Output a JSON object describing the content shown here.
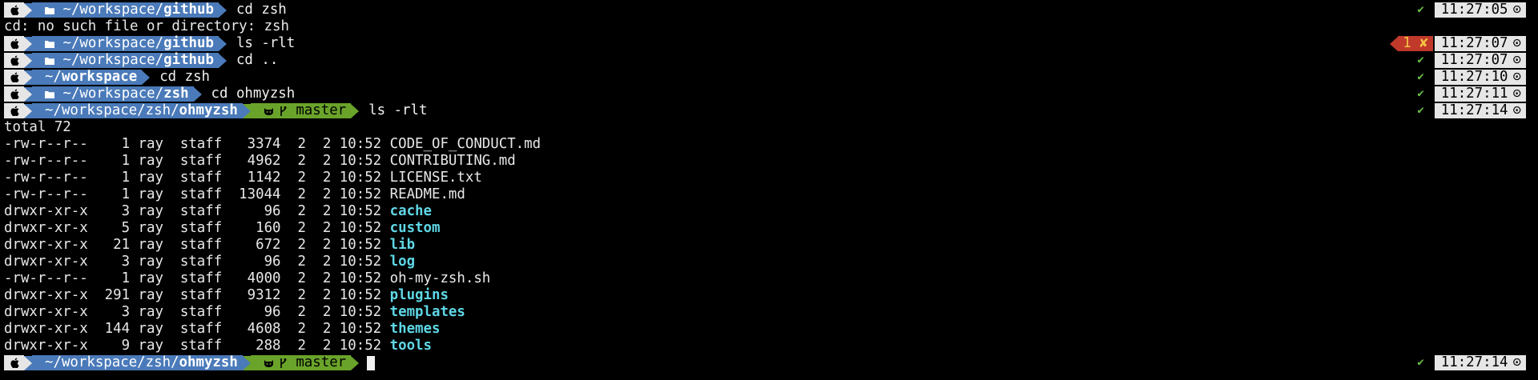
{
  "prompts": [
    {
      "path_prefix": "~/workspace/",
      "path_last": "github",
      "git": null,
      "command": "cd zsh",
      "status": "ok",
      "time": "11:27:05"
    },
    {
      "path_prefix": "~/workspace/",
      "path_last": "github",
      "git": null,
      "command": "ls -rlt",
      "status": "error",
      "error_code": "1",
      "error_mark": "✘",
      "time": "11:27:07"
    },
    {
      "path_prefix": "~/workspace/",
      "path_last": "github",
      "git": null,
      "command": "cd ..",
      "status": "ok",
      "time": "11:27:07"
    },
    {
      "path_prefix": "~/",
      "path_last": "workspace",
      "git": null,
      "command": "cd zsh",
      "status": "ok",
      "time": "11:27:10"
    },
    {
      "path_prefix": "~/workspace/",
      "path_last": "zsh",
      "git": null,
      "command": "cd ohmyzsh",
      "status": "ok",
      "time": "11:27:11"
    },
    {
      "path_prefix": "~/workspace/zsh/",
      "path_last": "ohmyzsh",
      "git": "master",
      "command": "ls -rlt",
      "status": "ok",
      "time": "11:27:14"
    },
    {
      "path_prefix": "~/workspace/zsh/",
      "path_last": "ohmyzsh",
      "git": "master",
      "command": "",
      "status": "ok",
      "time": "11:27:14"
    }
  ],
  "error_message": "cd: no such file or directory: zsh",
  "total_line": "total 72",
  "listing": [
    {
      "meta": "-rw-r--r--    1 ray  staff   3374  2  2 10:52 ",
      "name": "CODE_OF_CONDUCT.md",
      "dir": false
    },
    {
      "meta": "-rw-r--r--    1 ray  staff   4962  2  2 10:52 ",
      "name": "CONTRIBUTING.md",
      "dir": false
    },
    {
      "meta": "-rw-r--r--    1 ray  staff   1142  2  2 10:52 ",
      "name": "LICENSE.txt",
      "dir": false
    },
    {
      "meta": "-rw-r--r--    1 ray  staff  13044  2  2 10:52 ",
      "name": "README.md",
      "dir": false
    },
    {
      "meta": "drwxr-xr-x    3 ray  staff     96  2  2 10:52 ",
      "name": "cache",
      "dir": true
    },
    {
      "meta": "drwxr-xr-x    5 ray  staff    160  2  2 10:52 ",
      "name": "custom",
      "dir": true
    },
    {
      "meta": "drwxr-xr-x   21 ray  staff    672  2  2 10:52 ",
      "name": "lib",
      "dir": true
    },
    {
      "meta": "drwxr-xr-x    3 ray  staff     96  2  2 10:52 ",
      "name": "log",
      "dir": true
    },
    {
      "meta": "-rw-r--r--    1 ray  staff   4000  2  2 10:52 ",
      "name": "oh-my-zsh.sh",
      "dir": false
    },
    {
      "meta": "drwxr-xr-x  291 ray  staff   9312  2  2 10:52 ",
      "name": "plugins",
      "dir": true
    },
    {
      "meta": "drwxr-xr-x    3 ray  staff     96  2  2 10:52 ",
      "name": "templates",
      "dir": true
    },
    {
      "meta": "drwxr-xr-x  144 ray  staff   4608  2  2 10:52 ",
      "name": "themes",
      "dir": true
    },
    {
      "meta": "drwxr-xr-x    9 ray  staff    288  2  2 10:52 ",
      "name": "tools",
      "dir": true
    }
  ],
  "icons": {
    "os": "apple-icon",
    "folder": "folder-icon",
    "git_platform": "github-icon",
    "branch": "git-branch-icon",
    "ok": "checkmark-icon",
    "clock": "clock-icon"
  },
  "colors": {
    "background": "#000000",
    "path_segment": "#4a7ab9",
    "git_segment": "#6aa32a",
    "os_segment": "#e6e6e6",
    "error_segment": "#c0392b",
    "directory": "#5fd7e6",
    "ok": "#6cc24a"
  }
}
